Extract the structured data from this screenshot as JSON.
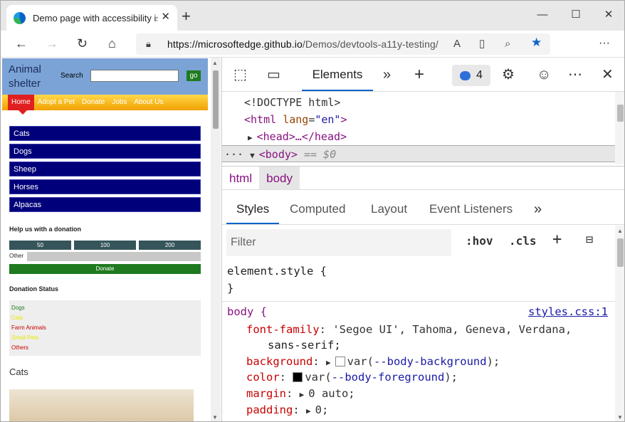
{
  "browser": {
    "tab_title": "Demo page with accessibility issues",
    "tab_close": "✕",
    "new_tab": "+",
    "window_controls": [
      "—",
      "☐",
      "✕"
    ],
    "url_host": "https://microsoftedge.github.io",
    "url_path": "/Demos/devtools-a11y-testing/",
    "more": "···"
  },
  "page": {
    "logo_line1": "Animal",
    "logo_line2": "shelter",
    "search_label": "Search",
    "go_label": "go",
    "nav": [
      "Home",
      "Adopt a Pet",
      "Donate",
      "Jobs",
      "About Us"
    ],
    "animals": [
      "Cats",
      "Dogs",
      "Sheep",
      "Horses",
      "Alpacas"
    ],
    "donation_heading": "Help us with a donation",
    "amounts": [
      "50",
      "100",
      "200"
    ],
    "other_label": "Other",
    "donate_label": "Donate",
    "status_heading": "Donation Status",
    "status": [
      {
        "label": "Dogs",
        "color": "#1f7a1f"
      },
      {
        "label": "Cats",
        "color": "#e8e800"
      },
      {
        "label": "Farm Animals",
        "color": "#c80000"
      },
      {
        "label": "Small Pets",
        "color": "#e8e800"
      },
      {
        "label": "Others",
        "color": "#c80000"
      }
    ],
    "cats_heading": "Cats"
  },
  "devtools": {
    "tab_elements": "Elements",
    "issues_count": "4",
    "dom": {
      "doctype": "<!DOCTYPE html>",
      "html_open": "<html",
      "lang_attr": "lang",
      "lang_value": "\"en\"",
      "html_close": ">",
      "head": "<head>…</head>",
      "body": "<body>",
      "eq0": "== $0",
      "ellipsis": "···"
    },
    "breadcrumbs": [
      "html",
      "body"
    ],
    "sub_tabs": [
      "Styles",
      "Computed",
      "Layout",
      "Event Listeners"
    ],
    "filter_placeholder": "Filter",
    "hov": ":hov",
    "cls": ".cls",
    "styles": {
      "element_style": "element.style {",
      "close_brace": "}",
      "body_selector": "body {",
      "source": "styles.css:1",
      "font_family_prop": "font-family",
      "font_family_val": "'Segoe UI', Tahoma, Geneva, Verdana,",
      "font_family_val2": "sans-serif;",
      "background_prop": "background",
      "background_var": "--body-background",
      "color_prop": "color",
      "color_var": "--body-foreground",
      "margin_prop": "margin",
      "margin_val": "0 auto;",
      "padding_prop": "padding",
      "padding_val": "0;"
    }
  }
}
